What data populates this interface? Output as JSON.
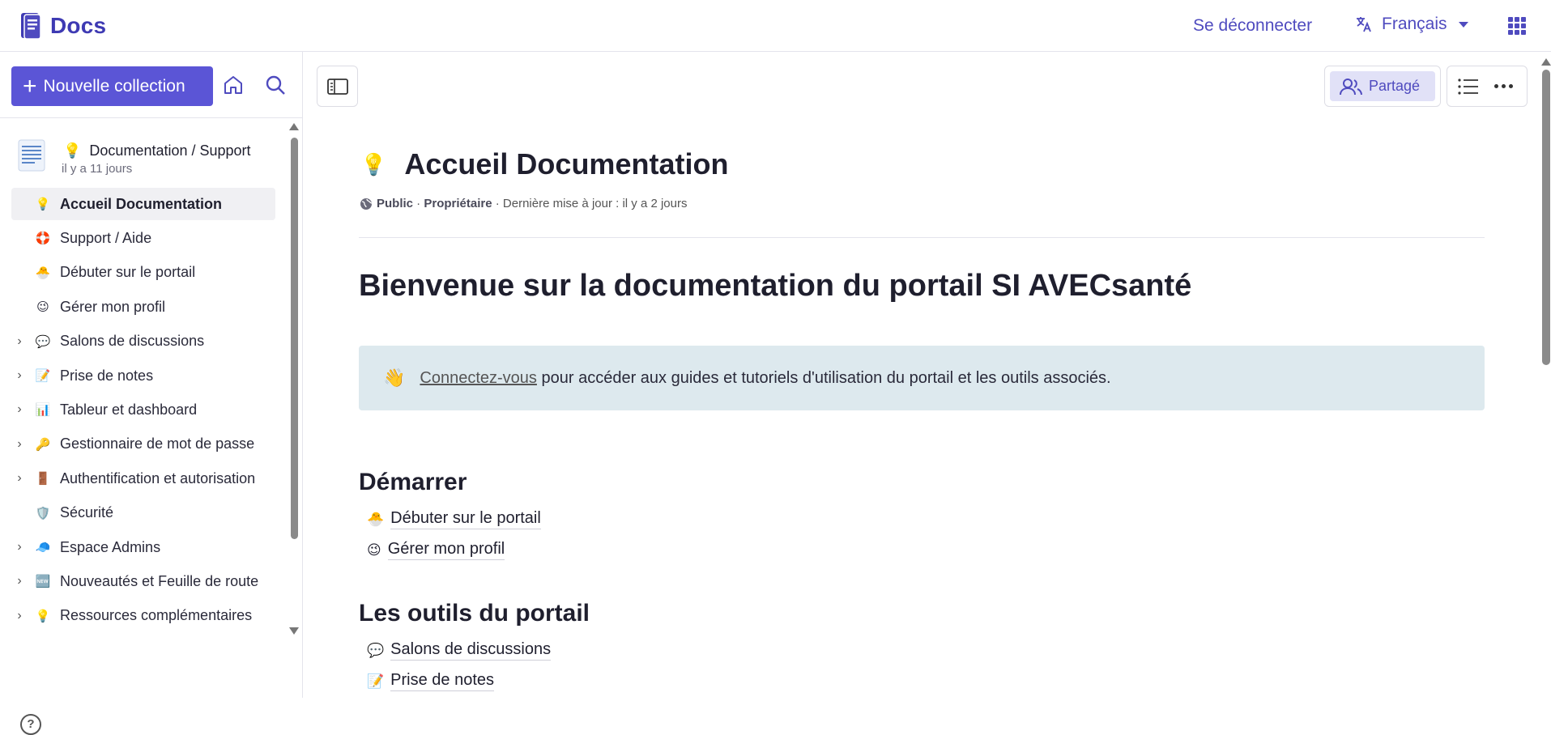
{
  "app": {
    "name": "Docs"
  },
  "header": {
    "logout": "Se déconnecter",
    "language": "Français"
  },
  "sidebar": {
    "new_collection": "Nouvelle collection",
    "collection": {
      "emoji": "💡",
      "title": "Documentation / Support",
      "subtitle": "il y a 11 jours"
    },
    "items": [
      {
        "emoji": "💡",
        "label": "Accueil Documentation",
        "expandable": false,
        "active": true
      },
      {
        "emoji": "🛟",
        "label": "Support / Aide",
        "expandable": false
      },
      {
        "emoji": "🐣",
        "label": "Débuter sur le portail",
        "expandable": false
      },
      {
        "emoji": "😉",
        "label": "Gérer mon profil",
        "expandable": false
      },
      {
        "emoji": "💬",
        "label": "Salons de discussions",
        "expandable": true
      },
      {
        "emoji": "📝",
        "label": "Prise de notes",
        "expandable": true
      },
      {
        "emoji": "📊",
        "label": "Tableur et dashboard",
        "expandable": true
      },
      {
        "emoji": "🔑",
        "label": "Gestionnaire de mot de passe",
        "expandable": true
      },
      {
        "emoji": "🚪",
        "label": "Authentification et autorisation",
        "expandable": true
      },
      {
        "emoji": "🛡️",
        "label": "Sécurité",
        "expandable": false
      },
      {
        "emoji": "🧢",
        "label": "Espace Admins",
        "expandable": true
      },
      {
        "emoji": "🆕",
        "label": "Nouveautés et Feuille de route",
        "expandable": true
      },
      {
        "emoji": "💡",
        "label": "Ressources complémentaires",
        "expandable": true
      }
    ]
  },
  "toolbar": {
    "share": "Partagé"
  },
  "document": {
    "emoji": "💡",
    "title": "Accueil Documentation",
    "meta": {
      "visibility": "Public",
      "role": "Propriétaire",
      "updated": "Dernière mise à jour : il y a 2 jours",
      "sep": " · "
    },
    "heading": "Bienvenue sur la documentation du portail SI AVECsanté",
    "callout": {
      "emoji": "👋",
      "link": "Connectez-vous",
      "text": " pour accéder aux guides et tutoriels d'utilisation du portail et les outils associés."
    },
    "sections": [
      {
        "title": "Démarrer",
        "links": [
          {
            "emoji": "🐣",
            "label": "Débuter sur le portail"
          },
          {
            "emoji": "😉",
            "label": "Gérer mon profil"
          }
        ]
      },
      {
        "title": "Les outils du portail",
        "links": [
          {
            "emoji": "💬",
            "label": "Salons de discussions"
          },
          {
            "emoji": "📝",
            "label": "Prise de notes"
          }
        ]
      }
    ]
  },
  "colors": {
    "accent": "#5b55d6",
    "link": "#4f4bbf",
    "callout_bg": "#dde9ee",
    "active_bg": "#f0f0f3"
  }
}
